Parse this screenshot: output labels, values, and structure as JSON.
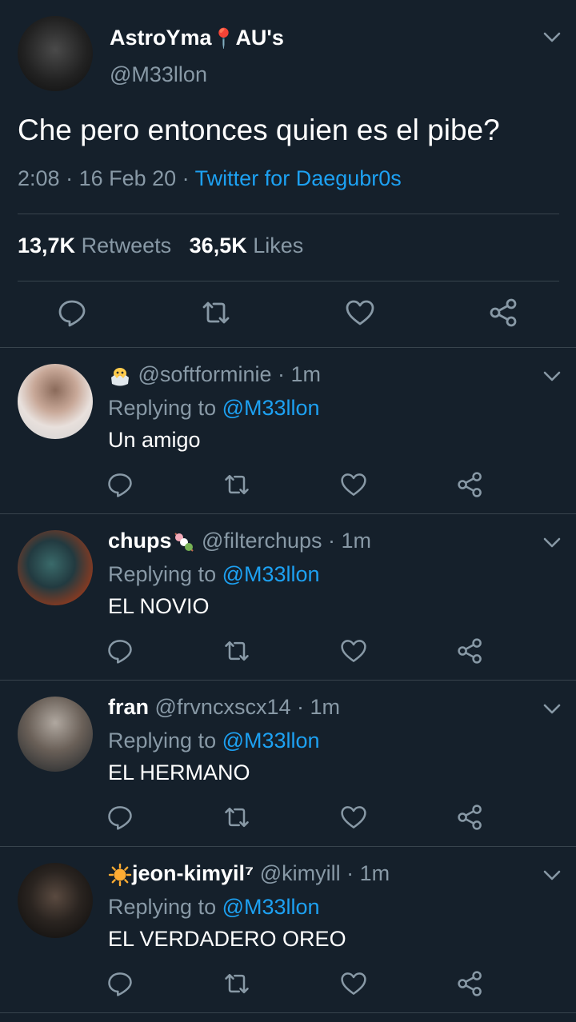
{
  "main": {
    "display_name": "AstroYma",
    "name_suffix": "AU's",
    "handle": "@M33llon",
    "text": "Che pero entonces quien es el pibe?",
    "time": "2:08",
    "date": "16 Feb 20",
    "source": "Twitter for Daegubr0s",
    "retweets_count": "13,7K",
    "retweets_label": "Retweets",
    "likes_count": "36,5K",
    "likes_label": "Likes"
  },
  "replies": [
    {
      "name": "",
      "handle": "@softforminie",
      "time": "1m",
      "replying_label": "Replying to",
      "mention": "@M33llon",
      "text": "Un amigo"
    },
    {
      "name": "chups",
      "handle": "@filterchups",
      "time": "1m",
      "replying_label": "Replying to",
      "mention": "@M33llon",
      "text": "EL NOVIO"
    },
    {
      "name": "fran",
      "handle": "@frvncxscx14",
      "time": "1m",
      "replying_label": "Replying to",
      "mention": "@M33llon",
      "text": "EL HERMANO"
    },
    {
      "name": "jeon-kimyil⁷",
      "handle": "@kimyill",
      "time": "1m",
      "replying_label": "Replying to",
      "mention": "@M33llon",
      "text": "EL VERDADERO OREO"
    }
  ],
  "colors": {
    "background": "#15202b",
    "accent": "#1da1f2",
    "muted": "#8899a6",
    "divider": "#38444d"
  },
  "icons": [
    "chevron-down-icon",
    "reply-icon",
    "retweet-icon",
    "like-icon",
    "share-icon"
  ]
}
